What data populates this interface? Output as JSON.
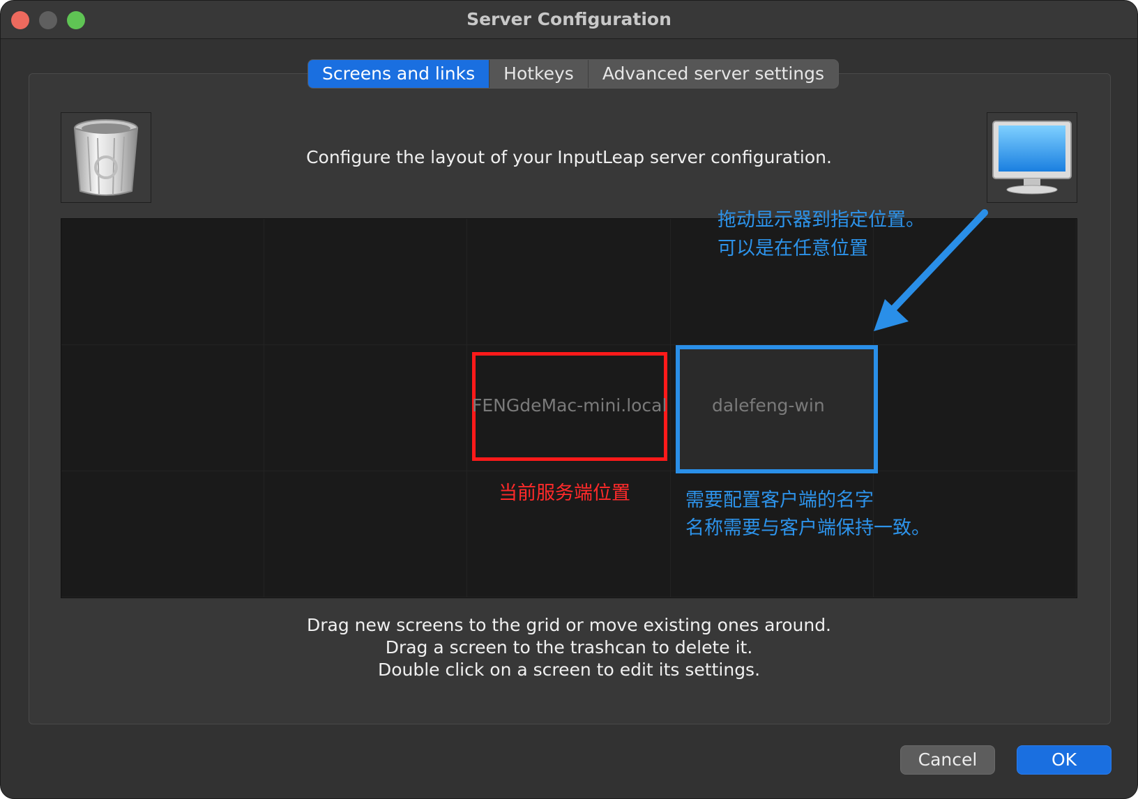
{
  "window": {
    "title": "Server Configuration"
  },
  "tabs": [
    {
      "label": "Screens and links",
      "active": true
    },
    {
      "label": "Hotkeys",
      "active": false
    },
    {
      "label": "Advanced server settings",
      "active": false
    }
  ],
  "intro": "Configure the layout of your InputLeap server configuration.",
  "icons": {
    "trash": "trash-icon",
    "new_screen": "monitor-icon"
  },
  "screens": [
    {
      "name": "FENGdeMac-mini.local"
    },
    {
      "name": "dalefeng-win"
    }
  ],
  "annotations": {
    "drag_hint_line1": "拖动显示器到指定位置。",
    "drag_hint_line2": "可以是在任意位置",
    "server_position": "当前服务端位置",
    "client_name_line1": "需要配置客户端的名字",
    "client_name_line2": "名称需要与客户端保持一致。",
    "colors": {
      "red": "#ff1a1a",
      "blue": "#2a8fe8"
    }
  },
  "help": {
    "line1": "Drag new screens to the grid or move existing ones around.",
    "line2": "Drag a screen to the trashcan to delete it.",
    "line3": "Double click on a screen to edit its settings."
  },
  "buttons": {
    "cancel": "Cancel",
    "ok": "OK"
  }
}
